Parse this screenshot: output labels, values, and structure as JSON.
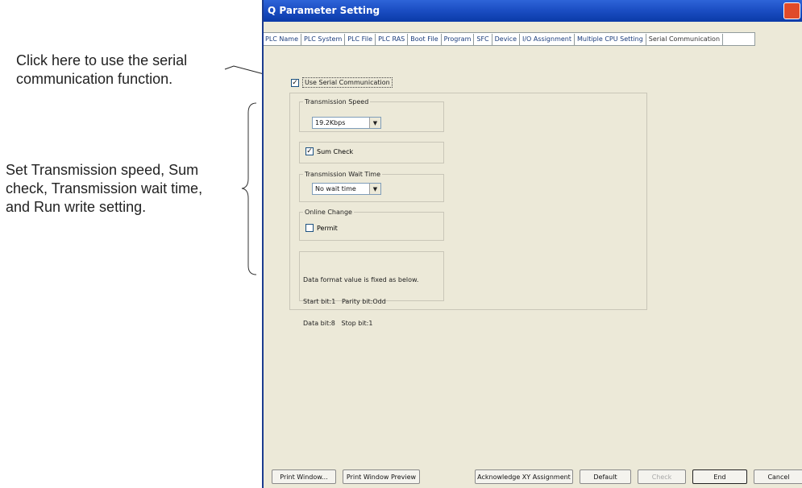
{
  "annotations": {
    "serial_hint": [
      "Click here to use the serial",
      "communication function."
    ],
    "settings_hint": [
      "Set Transmission speed, Sum",
      "check, Transmission wait time,",
      "and Run write setting."
    ]
  },
  "window": {
    "title": "Q Parameter Setting",
    "tabs": [
      {
        "label": "PLC Name"
      },
      {
        "label": "PLC System"
      },
      {
        "label": "PLC File"
      },
      {
        "label": "PLC RAS"
      },
      {
        "label": "Boot File"
      },
      {
        "label": "Program"
      },
      {
        "label": "SFC"
      },
      {
        "label": "Device"
      },
      {
        "label": "I/O Assignment"
      },
      {
        "label": "Multiple CPU Setting"
      },
      {
        "label": "Serial Communication",
        "active": true
      }
    ]
  },
  "serial": {
    "use_label": "Use Serial Communication",
    "use_checked": true,
    "speed_legend": "Transmission Speed",
    "speed_value": "19.2Kbps",
    "sum_check_label": "Sum Check",
    "sum_check_checked": true,
    "wait_legend": "Transmission Wait Time",
    "wait_value": "No wait time",
    "online_legend": "Online Change",
    "permit_label": "Permit",
    "permit_checked": false,
    "info_lines": [
      "Data format value is fixed as below.",
      "Start bit:1   Parity bit:Odd",
      "Data bit:8   Stop bit:1"
    ]
  },
  "buttons": {
    "print_window": "Print Window...",
    "print_preview": "Print Window Preview",
    "acknowledge_xy": "Acknowledge XY Assignment",
    "default": "Default",
    "check": "Check",
    "end": "End",
    "cancel": "Cancel"
  },
  "icons": {
    "checkmark": "check-icon",
    "dropdown": "chevron-down-icon",
    "close": "close-icon"
  }
}
